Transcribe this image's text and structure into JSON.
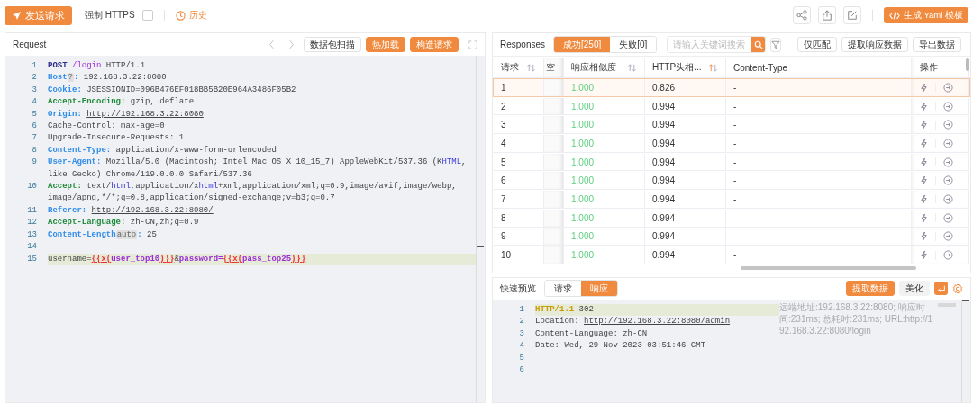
{
  "toolbar": {
    "send_button": "发送请求",
    "force_https": {
      "label": "强制 HTTPS",
      "checked": false
    },
    "history": "历史",
    "yaml_button": "生成 Yaml 模板"
  },
  "request_panel": {
    "title": "Request",
    "buttons": [
      {
        "label": "数据包扫描",
        "kind": "outline"
      },
      {
        "label": "热加载",
        "kind": "primary"
      },
      {
        "label": "构造请求",
        "kind": "primary"
      }
    ],
    "lines": [
      {
        "num": "1",
        "highlighted": false,
        "tokens": [
          {
            "kind": "m",
            "text": "POST "
          },
          {
            "kind": "p",
            "text": "/login"
          },
          {
            "kind": "t",
            "text": " HTTP/1.1"
          }
        ]
      },
      {
        "num": "2",
        "highlighted": false,
        "tokens": [
          {
            "kind": "k",
            "text": "Host"
          },
          {
            "kind": "b",
            "text": "?"
          },
          {
            "kind": "k",
            "text": ":"
          },
          {
            "kind": "t",
            "text": " 192.168.3.22:8080"
          }
        ]
      },
      {
        "num": "3",
        "highlighted": false,
        "tokens": [
          {
            "kind": "k",
            "text": "Cookie:"
          },
          {
            "kind": "t",
            "text": " JSESSIONID=096B476EF018BB5B20E964A3486F05B2"
          }
        ]
      },
      {
        "num": "4",
        "highlighted": false,
        "tokens": [
          {
            "kind": "g",
            "text": "Accept-Encoding:"
          },
          {
            "kind": "t",
            "text": " gzip, deflate"
          }
        ]
      },
      {
        "num": "5",
        "highlighted": false,
        "tokens": [
          {
            "kind": "k",
            "text": "Origin: "
          },
          {
            "kind": "u",
            "text": "http://192.168.3.22:8080"
          }
        ]
      },
      {
        "num": "6",
        "highlighted": false,
        "tokens": [
          {
            "kind": "t",
            "text": "Cache-Control: max-age=0"
          }
        ]
      },
      {
        "num": "7",
        "highlighted": false,
        "tokens": [
          {
            "kind": "t",
            "text": "Upgrade-Insecure-Requests: 1"
          }
        ]
      },
      {
        "num": "8",
        "highlighted": false,
        "tokens": [
          {
            "kind": "k",
            "text": "Content-Type:"
          },
          {
            "kind": "t",
            "text": " application/x-www-form-urlencoded"
          }
        ]
      },
      {
        "num": "9",
        "highlighted": false,
        "tokens": [
          {
            "kind": "k",
            "text": "User-Agent:"
          },
          {
            "kind": "t",
            "text": " Mozilla/5.0 (Macintosh; Intel Mac OS X 10_15_7) AppleWebKit/537.36 (K"
          },
          {
            "kind": "h",
            "text": "HTML"
          },
          {
            "kind": "t",
            "text": ", like Gecko) Chrome/119.0.0.0 Safari/537.36"
          }
        ]
      },
      {
        "num": "10",
        "highlighted": false,
        "tokens": [
          {
            "kind": "g",
            "text": "Accept:"
          },
          {
            "kind": "t",
            "text": " text/"
          },
          {
            "kind": "h",
            "text": "html"
          },
          {
            "kind": "t",
            "text": ",application/x"
          },
          {
            "kind": "h",
            "text": "html"
          },
          {
            "kind": "t",
            "text": "+xml,application/xml;q=0.9,image/avif,image/webp, image/apng,*/*;q=0.8,application/signed-exchange;v=b3;q=0.7"
          }
        ]
      },
      {
        "num": "11",
        "highlighted": false,
        "tokens": [
          {
            "kind": "k",
            "text": "Referer: "
          },
          {
            "kind": "u",
            "text": "http://192.168.3.22:8080/"
          }
        ]
      },
      {
        "num": "12",
        "highlighted": false,
        "tokens": [
          {
            "kind": "g",
            "text": "Accept-Language:"
          },
          {
            "kind": "t",
            "text": " zh-CN,zh;q=0.9"
          }
        ]
      },
      {
        "num": "13",
        "highlighted": false,
        "tokens": [
          {
            "kind": "k",
            "text": "Content-Length"
          },
          {
            "kind": "b",
            "text": "auto"
          },
          {
            "kind": "k",
            "text": ":"
          },
          {
            "kind": "t",
            "text": " 25"
          }
        ]
      },
      {
        "num": "14",
        "highlighted": false
      },
      {
        "num": "15",
        "highlighted": true,
        "tokens": [
          {
            "kind": "t",
            "text": "username="
          },
          {
            "kind": "r",
            "text": "{{x("
          },
          {
            "kind": "v",
            "text": "user_top10"
          },
          {
            "kind": "r",
            "text": ")}}"
          },
          {
            "kind": "t",
            "text": "&"
          },
          {
            "kind": "v",
            "text": "password="
          },
          {
            "kind": "r",
            "text": "{{x("
          },
          {
            "kind": "v",
            "text": "pass_top25"
          },
          {
            "kind": "r",
            "text": ")}}"
          }
        ]
      }
    ]
  },
  "responses_panel": {
    "title": "Responses",
    "tabs": [
      {
        "label": "成功[250]",
        "selected": true
      },
      {
        "label": "失败[0]",
        "selected": false
      }
    ],
    "search": {
      "placeholder": "请输入关键词搜索"
    },
    "buttons": [
      "仅匹配",
      "提取响应数据",
      "导出数据"
    ],
    "columns": [
      {
        "label": "请求",
        "sorted": false
      },
      {
        "label": "空"
      },
      {
        "label": "响应相似度",
        "sorted": false
      },
      {
        "label": "HTTP头相...",
        "sorted": true
      },
      {
        "label": "Content-Type"
      },
      {
        "label": "操作"
      }
    ],
    "rows": [
      {
        "request": "1",
        "similarity": "1.000",
        "header_similarity": "0.826",
        "content_type": "-",
        "selected": true
      },
      {
        "request": "2",
        "similarity": "1.000",
        "header_similarity": "0.994",
        "content_type": "-",
        "selected": false
      },
      {
        "request": "3",
        "similarity": "1.000",
        "header_similarity": "0.994",
        "content_type": "-",
        "selected": false
      },
      {
        "request": "4",
        "similarity": "1.000",
        "header_similarity": "0.994",
        "content_type": "-",
        "selected": false
      },
      {
        "request": "5",
        "similarity": "1.000",
        "header_similarity": "0.994",
        "content_type": "-",
        "selected": false
      },
      {
        "request": "6",
        "similarity": "1.000",
        "header_similarity": "0.994",
        "content_type": "-",
        "selected": false
      },
      {
        "request": "7",
        "similarity": "1.000",
        "header_similarity": "0.994",
        "content_type": "-",
        "selected": false
      },
      {
        "request": "8",
        "similarity": "1.000",
        "header_similarity": "0.994",
        "content_type": "-",
        "selected": false
      },
      {
        "request": "9",
        "similarity": "1.000",
        "header_similarity": "0.994",
        "content_type": "-",
        "selected": false
      },
      {
        "request": "10",
        "similarity": "1.000",
        "header_similarity": "0.994",
        "content_type": "-",
        "selected": false
      }
    ]
  },
  "preview": {
    "title": "快速预览",
    "tabs": [
      {
        "label": "请求",
        "selected": false
      },
      {
        "label": "响应",
        "selected": true
      }
    ],
    "buttons": [
      {
        "label": "提取数据",
        "kind": "primary"
      },
      {
        "label": "美化",
        "kind": "plain"
      }
    ],
    "lines": [
      {
        "num": "1",
        "highlighted": true,
        "tokens": [
          {
            "kind": "y",
            "text": "HTTP/1.1"
          },
          {
            "kind": "t",
            "text": " 302"
          }
        ]
      },
      {
        "num": "2",
        "highlighted": false,
        "tokens": [
          {
            "kind": "t",
            "text": "Location: "
          },
          {
            "kind": "u",
            "text": "http://192.168.3.22:8080/admin"
          }
        ]
      },
      {
        "num": "3",
        "highlighted": false,
        "tokens": [
          {
            "kind": "t",
            "text": "Content-Language: zh-CN"
          }
        ]
      },
      {
        "num": "4",
        "highlighted": false,
        "tokens": [
          {
            "kind": "t",
            "text": "Date: Wed, 29 Nov 2023 03:51:46 GMT"
          }
        ]
      },
      {
        "num": "5",
        "highlighted": false
      },
      {
        "num": "6",
        "highlighted": false
      }
    ],
    "info": "远端地址:192.168.3.22:8080; 响应时间:231ms; 总耗时:231ms; URL:http://192.168.3.22:8080/login"
  }
}
